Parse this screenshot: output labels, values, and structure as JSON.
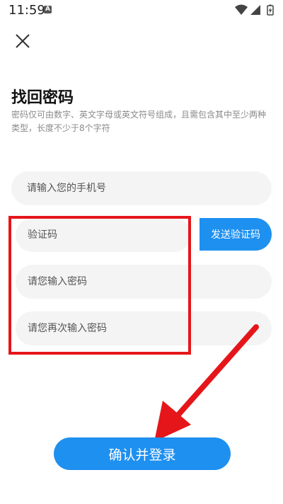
{
  "status_bar": {
    "time": "11:59",
    "notification_icon": "A",
    "icons": [
      "wifi-icon",
      "signal-icon",
      "battery-charging-icon"
    ]
  },
  "header": {
    "close_icon": "close-icon"
  },
  "main": {
    "title": "找回密码",
    "description": "密码仅可由数字、英文字母或英文符号组成，且需包含其中至少两种类型，长度不少于8个字符"
  },
  "form": {
    "phone_placeholder": "请输入您的手机号",
    "code_placeholder": "验证码",
    "send_code_label": "发送验证码",
    "password_placeholder": "请您输入密码",
    "password_confirm_placeholder": "请您再次输入密码",
    "submit_label": "确认并登录"
  },
  "annotation": {
    "highlight_color": "#e5161a"
  },
  "colors": {
    "accent": "#1e90f0",
    "field_bg": "#f4f4f4"
  }
}
